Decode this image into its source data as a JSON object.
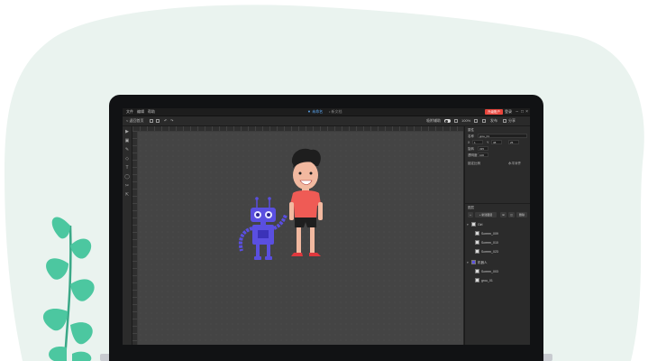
{
  "colors": {
    "background_blob": "#eaf3ef",
    "plant_leaf": "#4cc7a0",
    "accent_blue": "#5fb0ff",
    "publish_red": "#e8453c",
    "robot_blue": "#5a4fe0"
  },
  "menu": [
    "文件",
    "编辑",
    "帮助"
  ],
  "file_tabs": {
    "active": "▼ 未命名",
    "secondary": "• 新文档"
  },
  "top_right": {
    "publish_label": "升级账户",
    "login_label": "登录"
  },
  "window_controls": [
    "–",
    "□",
    "×"
  ],
  "toolbar": {
    "back_label": "< 返回首页",
    "snap_label": "吸附辅助",
    "zoom_label": "100%",
    "export_label": "发布",
    "share_label": "分享"
  },
  "tools": [
    "▶",
    "▣",
    "✎",
    "◇",
    "T",
    "◯",
    "✂",
    "⇱"
  ],
  "properties": {
    "title": "属性",
    "name_label": "名称",
    "name_value": "grou_01",
    "x_label": "X",
    "x_value": "1",
    "y_label": "Y",
    "y_value": "38",
    "w_value": "25",
    "rotation_label": "旋转",
    "rotation_value": "335",
    "opacity_label": "透明度",
    "opacity_value": "100",
    "link_label": "锁定比例",
    "fit_label": "水平对齐"
  },
  "layers": {
    "title": "图层",
    "new_group_label": "+ 新建图层",
    "delete_label": "删除",
    "items": [
      {
        "name": "Girl",
        "type": "group",
        "level": 0
      },
      {
        "name": "Screen_009",
        "type": "shape",
        "level": 1
      },
      {
        "name": "Screen_010",
        "type": "shape",
        "level": 1
      },
      {
        "name": "Screen_023",
        "type": "shape",
        "level": 1
      },
      {
        "name": "机器人",
        "type": "group",
        "level": 0
      },
      {
        "name": "Screen_003",
        "type": "shape",
        "level": 1
      },
      {
        "name": "grou_01",
        "type": "shape",
        "level": 1
      }
    ]
  }
}
